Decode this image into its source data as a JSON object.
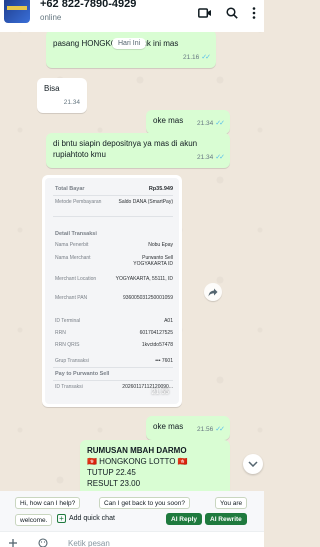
{
  "header": {
    "contact_name": "+62 822-7890-4929",
    "status": "online",
    "icons": [
      "video-call-icon",
      "search-icon",
      "more-options-icon"
    ]
  },
  "date_separator": "Hari Ini",
  "messages": [
    {
      "direction": "out",
      "text": "pasang HONGKONG untuk ini mas",
      "time": "21.16"
    },
    {
      "direction": "in",
      "text": "Bisa",
      "time": "21.34"
    },
    {
      "direction": "out",
      "text": "oke mas",
      "time": "21.34"
    },
    {
      "direction": "out",
      "text": "di bntu siapin depositnya ya mas di akun rupiahtoto kmu",
      "time": "21.34"
    },
    {
      "direction": "out",
      "text": "oke mas",
      "time": "21.56"
    }
  ],
  "image_message": {
    "time": "21.55",
    "receipt": {
      "total_label": "Total Bayar",
      "total_value": "Rp35.949",
      "method_label": "Metode Pembayaran",
      "method_value": "Saldo DANA (SmartPay)",
      "section_title": "Detail Transaksi",
      "rows": [
        {
          "k": "Nama Penerbit",
          "v": "Nobu Epay"
        },
        {
          "k": "Nama Merchant",
          "v": "Purwanto Sell YOGYAKARTA ID"
        },
        {
          "k": "Merchant Location",
          "v": "YOGYAKARTA, 55111, ID"
        },
        {
          "k": "Merchant PAN",
          "v": "936005031250001059"
        },
        {
          "k": "ID Terminal",
          "v": "A01"
        },
        {
          "k": "RRN",
          "v": "601704127525"
        },
        {
          "k": "RRN QRIS",
          "v": "1kvctdo57478"
        },
        {
          "k": "Grup Transaksi",
          "v": "••• 7601"
        }
      ],
      "pay_to": "Pay to Purwanto Sell",
      "id_label": "ID Transaksi",
      "id_value": "20260117112120090..."
    }
  },
  "last_message": {
    "title": "RUMUSAN MBAH DARMO",
    "line1": "🇭🇰 HONGKONG LOTTO 🇭🇰",
    "line2": "TUTUP 22.45",
    "line3": "RESULT 23.00"
  },
  "quick_replies": {
    "chips": [
      "Hi, how can I help?",
      "Can I get back to you soon?",
      "You are",
      "welcome."
    ],
    "add_label": "Add quick chat",
    "ai_reply": "AI Reply",
    "ai_rewrite": "AI Rewrite"
  },
  "input": {
    "placeholder": "Ketik pesan"
  },
  "colors": {
    "outgoing_bubble": "#d9fdd3",
    "incoming_bubble": "#ffffff",
    "read_ticks": "#53bdeb",
    "accent_green": "#1f7a3e"
  }
}
